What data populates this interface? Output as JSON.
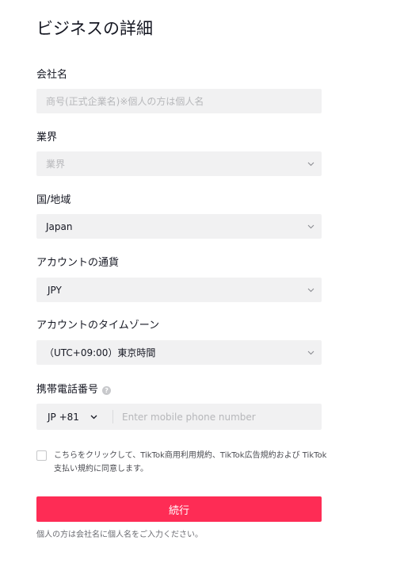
{
  "page": {
    "title": "ビジネスの詳細"
  },
  "fields": {
    "company_name": {
      "label": "会社名",
      "placeholder": "商号(正式企業名)※個人の方は個人名"
    },
    "industry": {
      "label": "業界",
      "placeholder": "業界"
    },
    "country": {
      "label": "国/地域",
      "value": "Japan"
    },
    "currency": {
      "label": "アカウントの通貨",
      "value": "JPY"
    },
    "timezone": {
      "label": "アカウントのタイムゾーン",
      "value": "（UTC+09:00）東京時間"
    },
    "phone": {
      "label": "携帯電話番号",
      "help_icon": "?",
      "country_code": "JP +81",
      "placeholder": "Enter mobile phone number"
    }
  },
  "agreement": {
    "text": "こちらをクリックして、TikTok商用利用規約、TikTok広告規約および TikTok支払い規約に同意します。",
    "checked": false
  },
  "submit": {
    "label": "続行"
  },
  "footnote": "個人の方は会社名に個人名をご入力ください。",
  "icons": {
    "select_arrow": "chevron-down-icon",
    "help": "question-circle-icon"
  },
  "colors": {
    "accent": "#fe2c55",
    "field_background": "#f1f1f2",
    "placeholder": "#b6b7ba",
    "text": "#161823"
  }
}
